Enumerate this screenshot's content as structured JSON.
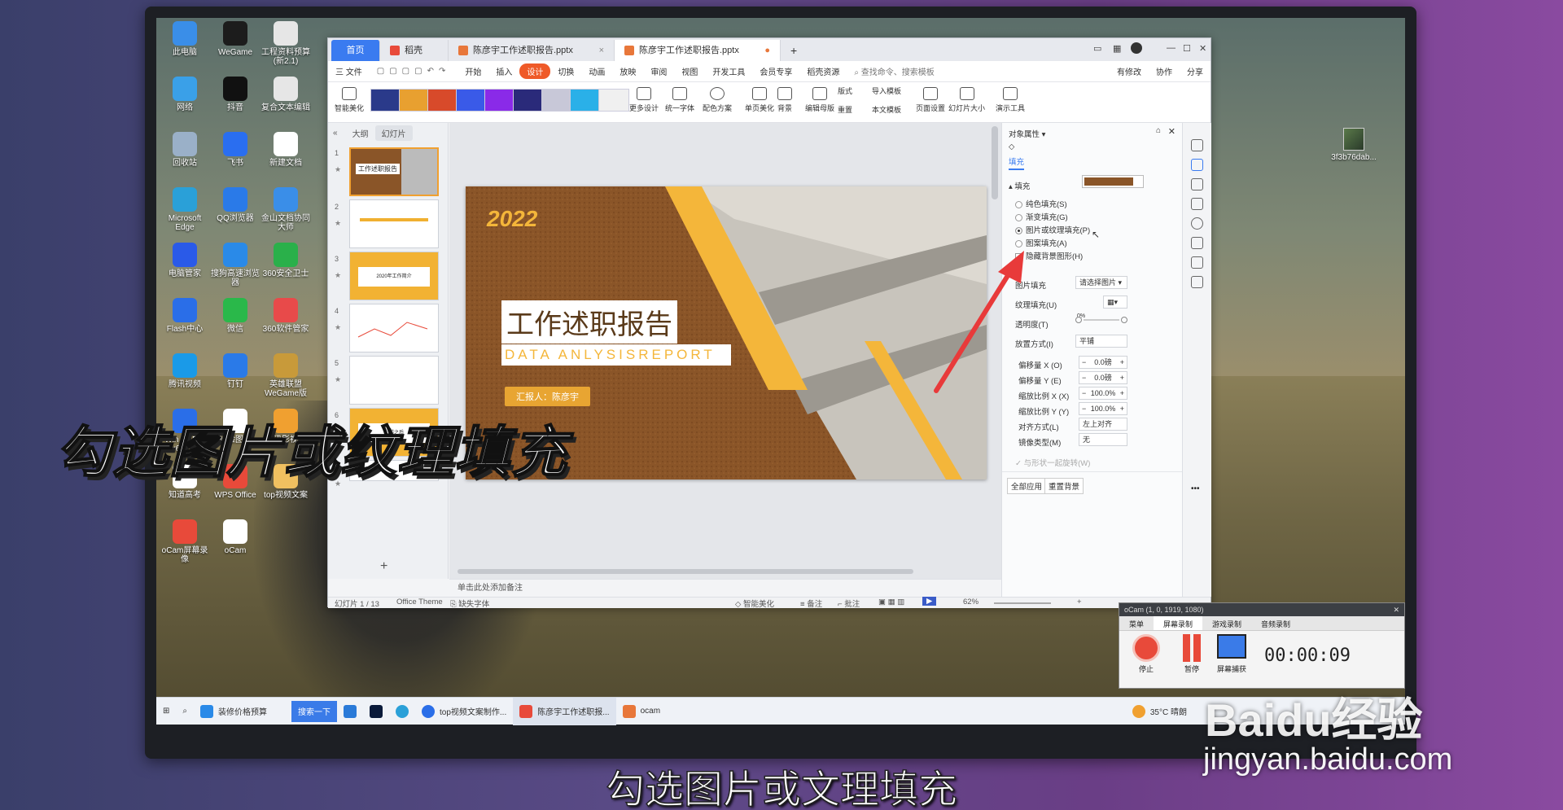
{
  "desktop": {
    "icons": [
      {
        "label": "此电脑",
        "color": "#3a8ee8"
      },
      {
        "label": "WeGame",
        "color": "#1c1c1c"
      },
      {
        "label": "工程资料预算(新2.1)",
        "color": "#e6e6e6"
      },
      {
        "label": "网络",
        "color": "#3aa0e8"
      },
      {
        "label": "抖音",
        "color": "#111111"
      },
      {
        "label": "复合文本编辑",
        "color": "#e6e6e6"
      },
      {
        "label": "回收站",
        "color": "#9ab0c8"
      },
      {
        "label": "飞书",
        "color": "#2a6ef0"
      },
      {
        "label": "新建文档",
        "color": "#ffffff"
      },
      {
        "label": "Microsoft Edge",
        "color": "#2aa0d8"
      },
      {
        "label": "QQ浏览器",
        "color": "#2a7ae8"
      },
      {
        "label": "金山文档协同大师",
        "color": "#3a8ee8"
      },
      {
        "label": "电脑管家",
        "color": "#2a5ae8"
      },
      {
        "label": "搜狗高速浏览器",
        "color": "#2a8ae8"
      },
      {
        "label": "360安全卫士",
        "color": "#2ab04a"
      },
      {
        "label": "Flash中心",
        "color": "#2a6ee8"
      },
      {
        "label": "微信",
        "color": "#2ab84a"
      },
      {
        "label": "360软件管家",
        "color": "#e84a4a"
      },
      {
        "label": "腾讯视频",
        "color": "#1a9ae8"
      },
      {
        "label": "钉钉",
        "color": "#2a7ae8"
      },
      {
        "label": "英雄联盟WeGame版",
        "color": "#c89a3a"
      },
      {
        "label": "Win 10 Pro x64 (C)",
        "color": "#2a6ee8"
      },
      {
        "label": "经验图文",
        "color": "#ffffff"
      },
      {
        "label": "腾讯影视库",
        "color": "#f0a030"
      },
      {
        "label": "知道高考",
        "color": "#ffffff"
      },
      {
        "label": "WPS Office",
        "color": "#e84a3a"
      },
      {
        "label": "top视频文案",
        "color": "#f0c060"
      },
      {
        "label": "oCam屏幕录像",
        "color": "#e84a3a"
      },
      {
        "label": "oCam",
        "color": "#ffffff"
      }
    ],
    "right_icon_label": "3f3b76dab..."
  },
  "wps": {
    "tabs": {
      "home": "首页",
      "draft": "稻壳",
      "file1": "陈彦宇工作述职报告.pptx",
      "file2": "陈彦宇工作述职报告.pptx",
      "add": "+"
    },
    "menu": {
      "file": "三 文件",
      "items": [
        "开始",
        "插入",
        "设计",
        "切换",
        "动画",
        "放映",
        "审阅",
        "视图",
        "开发工具",
        "会员专享",
        "稻壳资源"
      ],
      "selected": "设计",
      "search": "查找命令、搜索模板",
      "right": [
        "有修改",
        "协作",
        "分享"
      ]
    },
    "ribbon": {
      "smart": "智能美化",
      "more_design": "更多设计",
      "unify_font": "统一字体",
      "color_scheme": "配色方案",
      "single_page": "单页美化",
      "background": "背景",
      "edit_master": "编辑母版",
      "layout": "版式",
      "reset": "重置",
      "import_template": "导入模板",
      "this_template": "本文模板",
      "page_setup": "页面设置",
      "slide_size": "幻灯片大小",
      "presentation_tools": "演示工具"
    },
    "leftpane": {
      "tab_outline": "大纲",
      "tab_slides": "幻灯片",
      "thumb1_title": "工作述职报告",
      "thumb3_text": "2020年工作简介",
      "thumb6_text": "目前之后"
    },
    "slide": {
      "year": "2022",
      "title": "工作述职报告",
      "subtitle": "DATA ANLYSISREPORT",
      "reporter": "汇报人：陈彦宇"
    },
    "notes": "单击此处添加备注",
    "panel": {
      "header": "对象属性",
      "tab_fill": "填充",
      "section_fill": "填充",
      "opt_solid": "纯色填充(S)",
      "opt_gradient": "渐变填充(G)",
      "opt_picture": "图片或纹理填充(P)",
      "opt_pattern": "图案填充(A)",
      "chk_hide": "隐藏背景图形(H)",
      "picture_fill_label": "图片填充",
      "picture_fill_value": "请选择图片",
      "texture_fill_label": "纹理填充(U)",
      "transparency_label": "透明度(T)",
      "transparency_value": "0%",
      "placement_label": "放置方式(I)",
      "placement_value": "平铺",
      "offset_x_label": "偏移量 X (O)",
      "offset_x_value": "0.0磅",
      "offset_y_label": "偏移量 Y (E)",
      "offset_y_value": "0.0磅",
      "scale_x_label": "缩放比例 X (X)",
      "scale_x_value": "100.0%",
      "scale_y_label": "缩放比例 Y (Y)",
      "scale_y_value": "100.0%",
      "align_label": "对齐方式(L)",
      "align_value": "左上对齐",
      "mirror_label": "镜像类型(M)",
      "mirror_value": "无",
      "rotate_with_shape": "与形状一起旋转(W)",
      "apply_all": "全部应用",
      "reset_bg": "重置背景"
    },
    "status": {
      "slide_count": "幻灯片 1 / 13",
      "theme": "Office Theme",
      "missing_font": "缺失字体",
      "smart": "智能美化",
      "notes": "备注",
      "comments": "批注",
      "zoom": "62%"
    }
  },
  "ocam": {
    "title": "oCam (1, 0, 1919, 1080)",
    "tabs": [
      "菜单",
      "屏幕录制",
      "游戏录制",
      "音频录制"
    ],
    "btn_stop": "停止",
    "btn_pause": "暂停",
    "btn_capture": "屏幕捕获",
    "timer": "00:00:09"
  },
  "taskbar": {
    "search_text": "装修价格预算",
    "search_btn": "搜索一下",
    "apps": [
      "top视频文案制作...",
      "陈彦宇工作述职报...",
      "ocam"
    ],
    "weather": "35°C 晴朗"
  },
  "overlay": {
    "big_caption": "勾选图片或纹理填充",
    "subtitle": "勾选图片或文理填充",
    "watermark_logo": "Baidu经验",
    "watermark_url": "jingyan.baidu.com"
  }
}
